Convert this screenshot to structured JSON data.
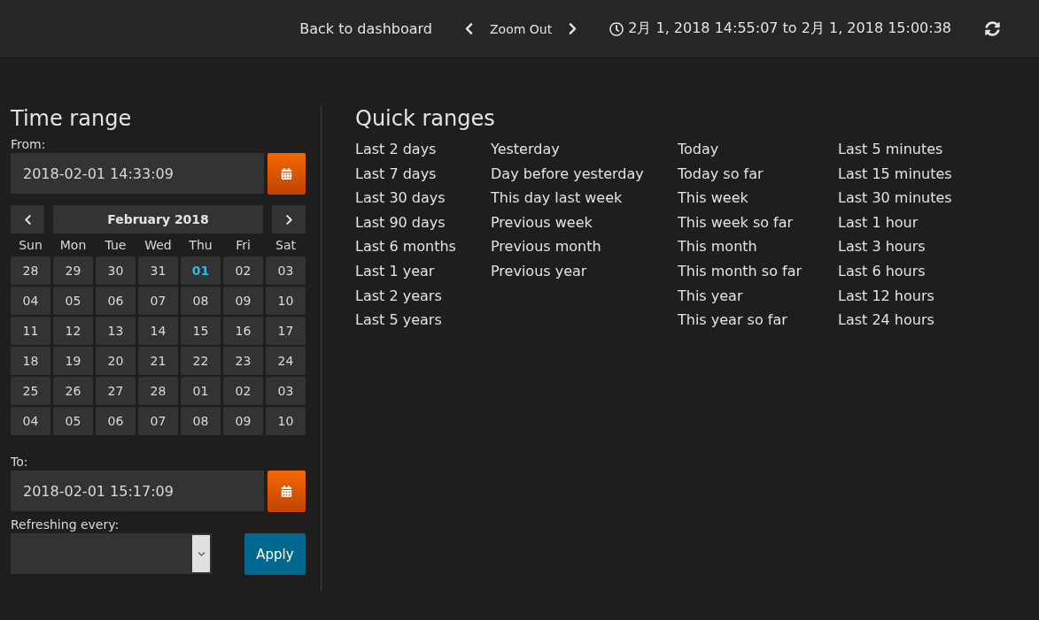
{
  "navbar": {
    "back_link": "Back to dashboard",
    "zoom_out": "Zoom Out",
    "range": "2月 1, 2018 14:55:07 to 2月 1, 2018 15:00:38"
  },
  "time_range": {
    "title": "Time range",
    "from_label": "From:",
    "from_value": "2018-02-01 14:33:09",
    "calendar": {
      "month": "February 2018",
      "weekdays": [
        "Sun",
        "Mon",
        "Tue",
        "Wed",
        "Thu",
        "Fri",
        "Sat"
      ],
      "weeks": [
        [
          {
            "label": "28",
            "selected": false
          },
          {
            "label": "29",
            "selected": false
          },
          {
            "label": "30",
            "selected": false
          },
          {
            "label": "31",
            "selected": false
          },
          {
            "label": "01",
            "selected": true
          },
          {
            "label": "02",
            "selected": false
          },
          {
            "label": "03",
            "selected": false
          }
        ],
        [
          {
            "label": "04",
            "selected": false
          },
          {
            "label": "05",
            "selected": false
          },
          {
            "label": "06",
            "selected": false
          },
          {
            "label": "07",
            "selected": false
          },
          {
            "label": "08",
            "selected": false
          },
          {
            "label": "09",
            "selected": false
          },
          {
            "label": "10",
            "selected": false
          }
        ],
        [
          {
            "label": "11",
            "selected": false
          },
          {
            "label": "12",
            "selected": false
          },
          {
            "label": "13",
            "selected": false
          },
          {
            "label": "14",
            "selected": false
          },
          {
            "label": "15",
            "selected": false
          },
          {
            "label": "16",
            "selected": false
          },
          {
            "label": "17",
            "selected": false
          }
        ],
        [
          {
            "label": "18",
            "selected": false
          },
          {
            "label": "19",
            "selected": false
          },
          {
            "label": "20",
            "selected": false
          },
          {
            "label": "21",
            "selected": false
          },
          {
            "label": "22",
            "selected": false
          },
          {
            "label": "23",
            "selected": false
          },
          {
            "label": "24",
            "selected": false
          }
        ],
        [
          {
            "label": "25",
            "selected": false
          },
          {
            "label": "26",
            "selected": false
          },
          {
            "label": "27",
            "selected": false
          },
          {
            "label": "28",
            "selected": false
          },
          {
            "label": "01",
            "selected": false
          },
          {
            "label": "02",
            "selected": false
          },
          {
            "label": "03",
            "selected": false
          }
        ],
        [
          {
            "label": "04",
            "selected": false
          },
          {
            "label": "05",
            "selected": false
          },
          {
            "label": "06",
            "selected": false
          },
          {
            "label": "07",
            "selected": false
          },
          {
            "label": "08",
            "selected": false
          },
          {
            "label": "09",
            "selected": false
          },
          {
            "label": "10",
            "selected": false
          }
        ]
      ]
    },
    "to_label": "To:",
    "to_value": "2018-02-01 15:17:09",
    "refresh_label": "Refreshing every:",
    "apply": "Apply"
  },
  "quick_ranges": {
    "title": "Quick ranges",
    "columns": [
      [
        "Last 2 days",
        "Last 7 days",
        "Last 30 days",
        "Last 90 days",
        "Last 6 months",
        "Last 1 year",
        "Last 2 years",
        "Last 5 years"
      ],
      [
        "Yesterday",
        "Day before yesterday",
        "This day last week",
        "Previous week",
        "Previous month",
        "Previous year"
      ],
      [
        "Today",
        "Today so far",
        "This week",
        "This week so far",
        "This month",
        "This month so far",
        "This year",
        "This year so far"
      ],
      [
        "Last 5 minutes",
        "Last 15 minutes",
        "Last 30 minutes",
        "Last 1 hour",
        "Last 3 hours",
        "Last 6 hours",
        "Last 12 hours",
        "Last 24 hours"
      ]
    ]
  }
}
